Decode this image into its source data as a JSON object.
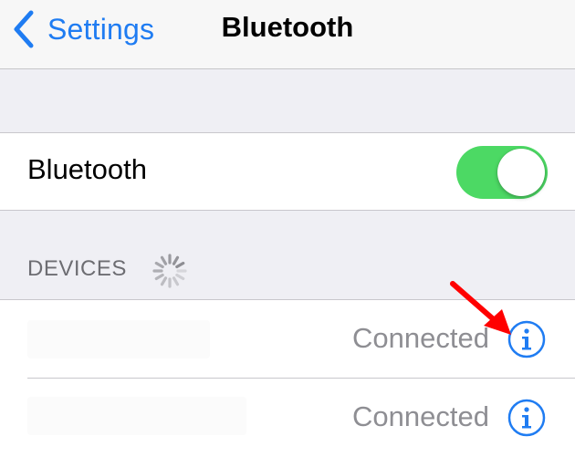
{
  "navbar": {
    "back_label": "Settings",
    "title": "Bluetooth"
  },
  "bluetooth": {
    "label": "Bluetooth",
    "enabled": true
  },
  "devices": {
    "header": "DEVICES",
    "items": [
      {
        "status": "Connected"
      },
      {
        "status": "Connected"
      }
    ]
  },
  "colors": {
    "accent": "#1f7cf2",
    "toggle_on": "#4cd964",
    "annotation": "#ff0000"
  },
  "icons": {
    "back": "chevron-left-icon",
    "spinner": "activity-spinner-icon",
    "info": "info-circle-icon",
    "annotation": "red-arrow-icon"
  }
}
